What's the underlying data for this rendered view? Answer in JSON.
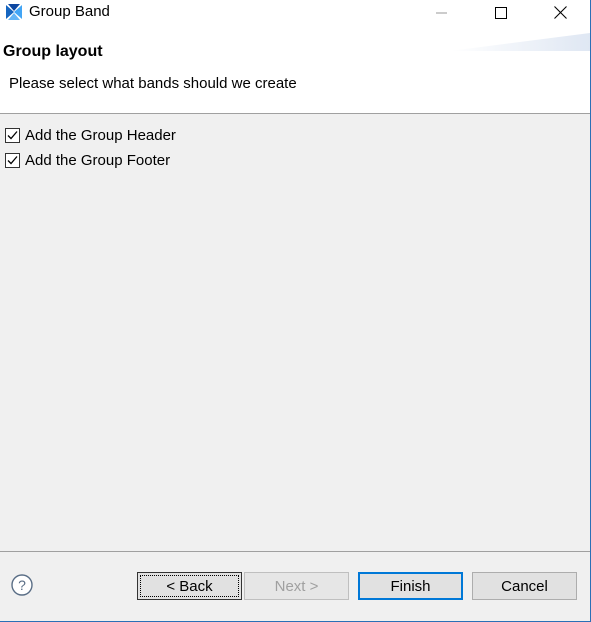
{
  "window": {
    "title": "Group Band",
    "icon": "eclipse-birt-icon",
    "controls": {
      "minimize": "minimize-icon",
      "maximize": "maximize-icon",
      "close": "close-icon"
    }
  },
  "header": {
    "page_title": "Group layout",
    "description": "Please select what bands should we create"
  },
  "options": [
    {
      "label": "Add the Group Header",
      "checked": true
    },
    {
      "label": "Add the Group Footer",
      "checked": true
    }
  ],
  "footer": {
    "help_icon": "help-icon",
    "back_label": "< Back",
    "next_label": "Next >",
    "finish_label": "Finish",
    "cancel_label": "Cancel"
  },
  "colors": {
    "accent": "#0078d7",
    "content_bg": "#f0f0f0",
    "disabled_text": "#a0a0a0"
  }
}
